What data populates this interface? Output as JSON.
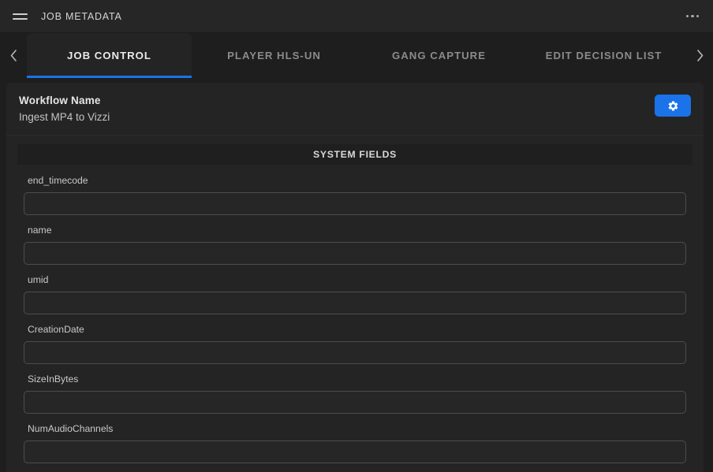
{
  "appbar": {
    "menu_icon": "hamburger-icon",
    "title": "JOB METADATA",
    "overflow_icon": "kebab-menu-icon"
  },
  "tabbar": {
    "prev_icon": "chevron-left-icon",
    "next_icon": "chevron-right-icon",
    "active_index": 0,
    "accent_color": "#1a73e8",
    "tabs": [
      {
        "label": "JOB CONTROL"
      },
      {
        "label": "PLAYER HLS-UN"
      },
      {
        "label": "GANG CAPTURE"
      },
      {
        "label": "EDIT DECISION LIST"
      }
    ]
  },
  "card": {
    "workflow_label": "Workflow Name",
    "workflow_value": "Ingest MP4 to Vizzi",
    "settings_button": {
      "icon": "gear-icon",
      "color": "#1a73e8"
    },
    "section_title": "SYSTEM FIELDS",
    "fields": [
      {
        "label": "end_timecode",
        "value": "",
        "placeholder": ""
      },
      {
        "label": "name",
        "value": "",
        "placeholder": ""
      },
      {
        "label": "umid",
        "value": "",
        "placeholder": ""
      },
      {
        "label": "CreationDate",
        "value": "",
        "placeholder": ""
      },
      {
        "label": "SizeInBytes",
        "value": "",
        "placeholder": ""
      },
      {
        "label": "NumAudioChannels",
        "value": "",
        "placeholder": ""
      }
    ]
  }
}
